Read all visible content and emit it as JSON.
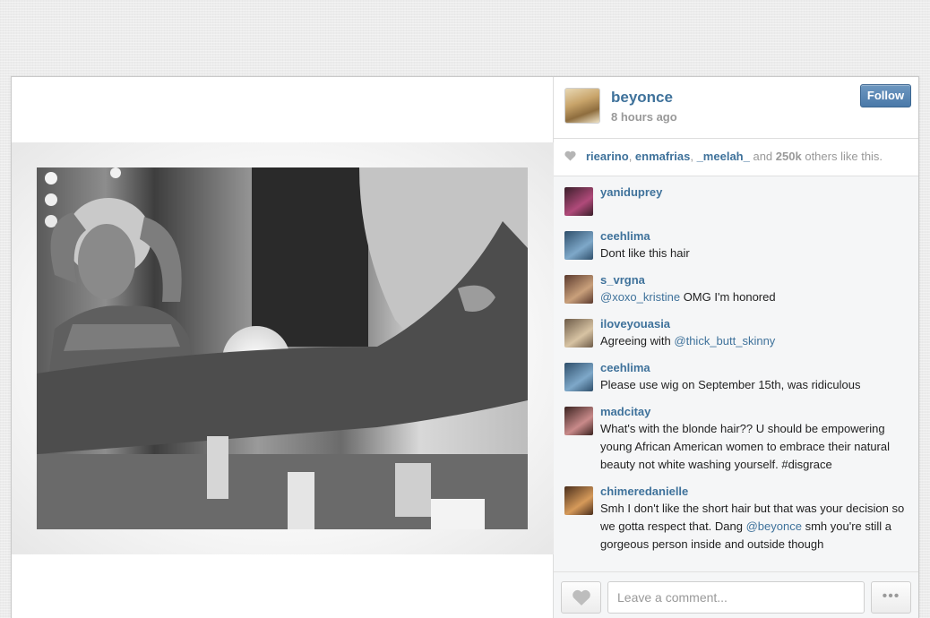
{
  "post": {
    "username": "beyonce",
    "time": "8 hours ago",
    "follow_label": "Follow"
  },
  "likes": {
    "users": [
      "riearino",
      "enmafrias",
      "_meelah_"
    ],
    "and_text": "and",
    "count": "250k",
    "suffix": "others like this."
  },
  "comments": [
    {
      "user": "yaniduprey",
      "parts": [
        {
          "t": "⁣⁣⁣⁣",
          "m": false
        }
      ],
      "avatar": [
        "#3a1f2a",
        "#b04a7a"
      ]
    },
    {
      "user": "ceehlima",
      "parts": [
        {
          "t": "Dont like this hair",
          "m": false
        }
      ],
      "avatar": [
        "#2f4f6b",
        "#7ea8c9"
      ]
    },
    {
      "user": "s_vrgna",
      "parts": [
        {
          "t": "@xoxo_kristine",
          "m": true
        },
        {
          "t": " OMG I'm honored",
          "m": false
        }
      ],
      "avatar": [
        "#5b3a2e",
        "#c9a07b"
      ]
    },
    {
      "user": "iloveyouasia",
      "parts": [
        {
          "t": "Agreeing with ",
          "m": false
        },
        {
          "t": "@thick_butt_skinny",
          "m": true
        }
      ],
      "avatar": [
        "#6d5b48",
        "#d7c3a3"
      ]
    },
    {
      "user": "ceehlima",
      "parts": [
        {
          "t": "Please use wig on September 15th, was ridiculous",
          "m": false
        }
      ],
      "avatar": [
        "#2f4f6b",
        "#7ea8c9"
      ]
    },
    {
      "user": "madcitay",
      "parts": [
        {
          "t": "What's with the blonde hair?? U should be empowering young African American women to embrace their natural beauty not white washing yourself. #disgrace",
          "m": false
        }
      ],
      "avatar": [
        "#3b2320",
        "#c98a8a"
      ]
    },
    {
      "user": "chimeredanielle",
      "parts": [
        {
          "t": "Smh I don't like the short hair but that was your decision so we gotta respect that. Dang ",
          "m": false
        },
        {
          "t": "@beyonce",
          "m": true
        },
        {
          "t": " smh you're still a gorgeous person inside and outside though",
          "m": false
        }
      ],
      "avatar": [
        "#4a2e1c",
        "#d69a5a"
      ]
    }
  ],
  "footer": {
    "comment_placeholder": "Leave a comment...",
    "more_label": "•••"
  },
  "colors": {
    "link": "#3f729b",
    "follow_button": "#4a79a9"
  }
}
